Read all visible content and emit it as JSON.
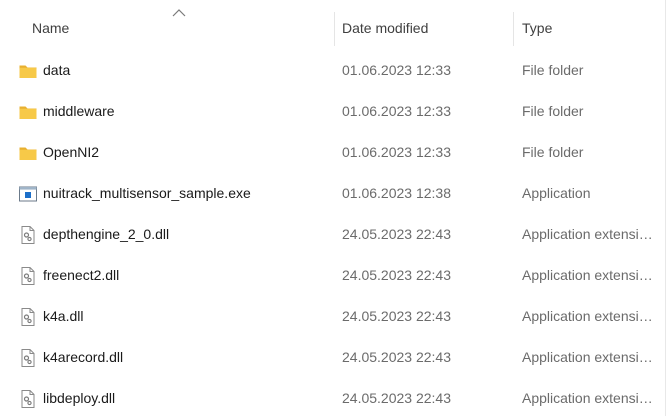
{
  "columns": {
    "name": "Name",
    "date_modified": "Date modified",
    "type": "Type"
  },
  "sort": {
    "column": "name",
    "direction": "ascending"
  },
  "files": [
    {
      "name": "data",
      "date": "01.06.2023 12:33",
      "type": "File folder",
      "icon": "folder-icon"
    },
    {
      "name": "middleware",
      "date": "01.06.2023 12:33",
      "type": "File folder",
      "icon": "folder-icon"
    },
    {
      "name": "OpenNI2",
      "date": "01.06.2023 12:33",
      "type": "File folder",
      "icon": "folder-icon"
    },
    {
      "name": "nuitrack_multisensor_sample.exe",
      "date": "01.06.2023 12:38",
      "type": "Application",
      "icon": "application-exe-icon"
    },
    {
      "name": "depthengine_2_0.dll",
      "date": "24.05.2023 22:43",
      "type": "Application extension",
      "icon": "dll-file-icon"
    },
    {
      "name": "freenect2.dll",
      "date": "24.05.2023 22:43",
      "type": "Application extension",
      "icon": "dll-file-icon"
    },
    {
      "name": "k4a.dll",
      "date": "24.05.2023 22:43",
      "type": "Application extension",
      "icon": "dll-file-icon"
    },
    {
      "name": "k4arecord.dll",
      "date": "24.05.2023 22:43",
      "type": "Application extension",
      "icon": "dll-file-icon"
    },
    {
      "name": "libdeploy.dll",
      "date": "24.05.2023 22:43",
      "type": "Application extension",
      "icon": "dll-file-icon"
    }
  ],
  "colors": {
    "folder": "#f7c948",
    "folder_tab": "#e8b030",
    "exe_accent": "#1c6fc9",
    "text_primary": "#1a1a1a",
    "text_secondary": "#6b6b6b"
  }
}
